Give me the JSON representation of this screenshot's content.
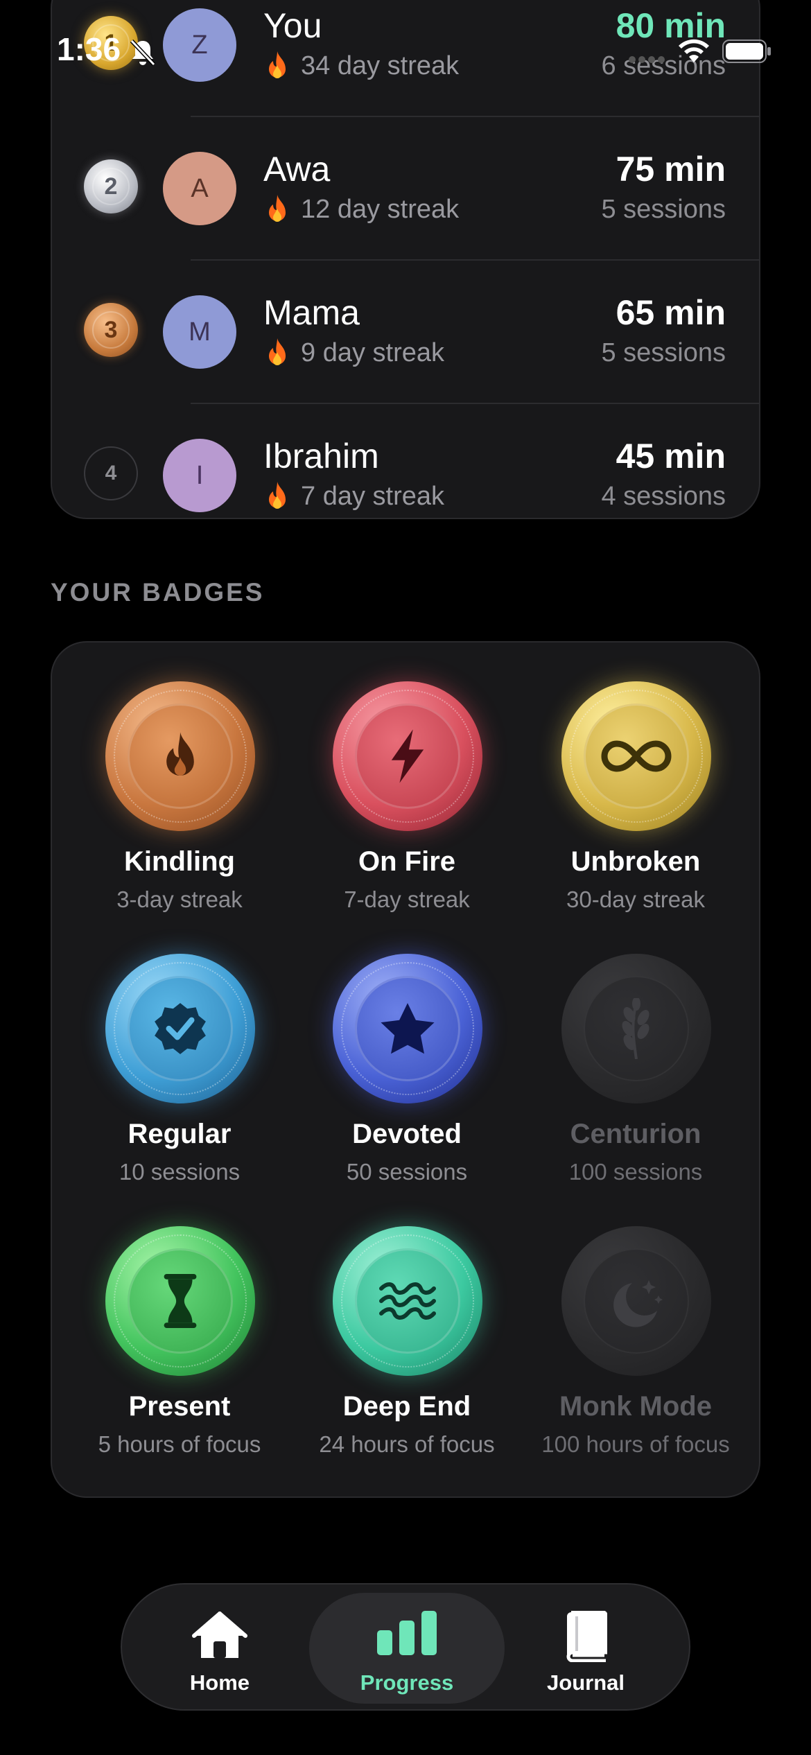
{
  "status_bar": {
    "time": "1:36"
  },
  "leaderboard": {
    "rows": [
      {
        "rank": "1",
        "initial": "Z",
        "name": "You",
        "streak": "34 day streak",
        "minutes": "80 min",
        "sessions": "6 sessions",
        "minutes_color": "#6fe6b9",
        "avatar_color": "#8f9ad6",
        "medal": "gold"
      },
      {
        "rank": "2",
        "initial": "A",
        "name": "Awa",
        "streak": "12 day streak",
        "minutes": "75 min",
        "sessions": "5 sessions",
        "minutes_color": "#ffffff",
        "avatar_color": "#d59a86",
        "medal": "silver"
      },
      {
        "rank": "3",
        "initial": "M",
        "name": "Mama",
        "streak": "9 day streak",
        "minutes": "65 min",
        "sessions": "5 sessions",
        "minutes_color": "#ffffff",
        "avatar_color": "#8f9ad6",
        "medal": "bronze"
      },
      {
        "rank": "4",
        "initial": "I",
        "name": "Ibrahim",
        "streak": "7 day streak",
        "minutes": "45 min",
        "sessions": "4 sessions",
        "minutes_color": "#ffffff",
        "avatar_color": "#b89ad0",
        "medal": "plain"
      }
    ]
  },
  "badges": {
    "section_title": "YOUR BADGES",
    "items": [
      {
        "name": "Kindling",
        "requirement": "3-day streak",
        "icon": "flame-icon",
        "color": "#c9773f",
        "locked": false
      },
      {
        "name": "On Fire",
        "requirement": "7-day streak",
        "icon": "lightning-icon",
        "color": "#d9505e",
        "locked": false
      },
      {
        "name": "Unbroken",
        "requirement": "30-day streak",
        "icon": "infinity-icon",
        "color": "#d8b84a",
        "locked": false
      },
      {
        "name": "Regular",
        "requirement": "10 sessions",
        "icon": "verified-check-icon",
        "color": "#3f9fd6",
        "locked": false
      },
      {
        "name": "Devoted",
        "requirement": "50 sessions",
        "icon": "star-icon",
        "color": "#4a62d6",
        "locked": false
      },
      {
        "name": "Centurion",
        "requirement": "100 sessions",
        "icon": "laurel-icon",
        "color": "#2a2a2c",
        "locked": true
      },
      {
        "name": "Present",
        "requirement": "5 hours of focus",
        "icon": "hourglass-icon",
        "color": "#43c45e",
        "locked": false
      },
      {
        "name": "Deep End",
        "requirement": "24 hours of focus",
        "icon": "waves-icon",
        "color": "#3cc9a0",
        "locked": false
      },
      {
        "name": "Monk Mode",
        "requirement": "100 hours of focus",
        "icon": "moon-stars-icon",
        "color": "#2a2a2c",
        "locked": true
      }
    ]
  },
  "tab_bar": {
    "tabs": [
      {
        "label": "Home",
        "icon": "home-icon",
        "active": false
      },
      {
        "label": "Progress",
        "icon": "bar-chart-icon",
        "active": true
      },
      {
        "label": "Journal",
        "icon": "book-icon",
        "active": false
      }
    ]
  }
}
